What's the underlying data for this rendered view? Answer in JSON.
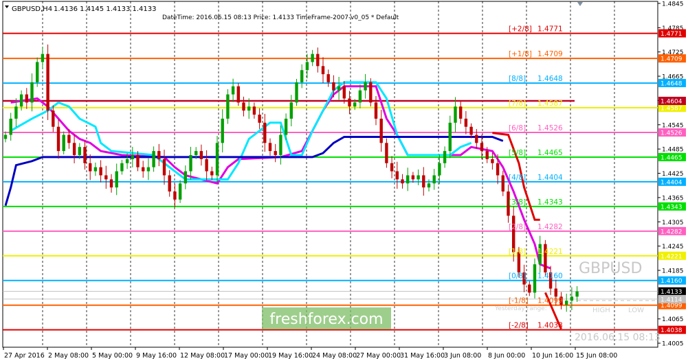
{
  "header": {
    "symbol_label": "GBPUSD,H4",
    "ohlc": "1.4136 1.4145 1.4133 1.4133",
    "info": "DateTime: 2016.06.15 08:13    Price: 1.4133    TimeFrame-2007-v0_05    *    Default"
  },
  "watermark": {
    "brand": "freshforex.com",
    "symbol": "GBPUSD",
    "datetime": "2016.06.15 08:13",
    "yesterday": "Yesterday range:",
    "high": "HIGH",
    "low": "LOW"
  },
  "colors": {
    "background": "#ffffff",
    "bull_candle": "#00a000",
    "bear_candle": "#c00000",
    "magenta": "#e000e0",
    "cyan": "#00e8ff",
    "blue": "#0000c0",
    "red_step": "#e00000",
    "grid": "#000000",
    "brand_box": "#7dbd66"
  },
  "chart_data": {
    "type": "candlestick",
    "ylim": [
      1.3995,
      1.485
    ],
    "y_ticks": [
      1.4845,
      1.4785,
      1.4725,
      1.4665,
      1.4605,
      1.4545,
      1.4485,
      1.4425,
      1.4365,
      1.4305,
      1.4245,
      1.4185,
      1.4125,
      1.4065,
      1.4005
    ],
    "x_labels": [
      "27 Apr 2016",
      "2 May 08:00",
      "5 May 00:00",
      "9 May 16:00",
      "12 May 08:00",
      "17 May 00:00",
      "19 May 16:00",
      "24 May 08:00",
      "27 May 00:00",
      "31 May 16:00",
      "3 Jun 08:00",
      "8 Jun 00:00",
      "10 Jun 16:00",
      "15 Jun 08:00"
    ],
    "murrey_levels": [
      {
        "label": "[+2/8]",
        "value": 1.4771,
        "price": "1.4771",
        "color": "#e00000"
      },
      {
        "label": "[+1/8]",
        "value": 1.4709,
        "price": "1.4709",
        "color": "#ff6000"
      },
      {
        "label": "[8/8]",
        "value": 1.4648,
        "price": "1.4648",
        "color": "#00b0ff"
      },
      {
        "label": "[7/8]",
        "value": 1.4587,
        "price": "1.4587",
        "color": "#f0f000"
      },
      {
        "label": "[6/8]",
        "value": 1.4526,
        "price": "1.4526",
        "color": "#ff60c0"
      },
      {
        "label": "[5/8]",
        "value": 1.4465,
        "price": "1.4465",
        "color": "#00e000"
      },
      {
        "label": "[4/8]",
        "value": 1.4404,
        "price": "1.4404",
        "color": "#00b0ff"
      },
      {
        "label": "[3/8]",
        "value": 1.4343,
        "price": "1.4343",
        "color": "#00e000"
      },
      {
        "label": "[2/8]",
        "value": 1.4282,
        "price": "1.4282",
        "color": "#ff60c0"
      },
      {
        "label": "[1/8]",
        "value": 1.4221,
        "price": "1.4221",
        "color": "#f0f000"
      },
      {
        "label": "[0/8]",
        "value": 1.416,
        "price": "1.4160",
        "color": "#00b0ff"
      },
      {
        "label": "[-1/8]",
        "value": 1.4099,
        "price": "1.4099",
        "color": "#ff6000"
      },
      {
        "label": "[-2/8]",
        "value": 1.4038,
        "price": "1.4038",
        "color": "#e00000"
      }
    ],
    "extra_lines": [
      {
        "value": 1.4604,
        "color": "#c00020",
        "price": "1.4604"
      }
    ],
    "price_markers": [
      {
        "value": 1.4133,
        "price": "1.4133",
        "color": "#000000"
      },
      {
        "value": 1.4114,
        "price": "1.4114",
        "color": "#c0c0c0"
      }
    ],
    "close_series": [
      1.452,
      1.456,
      1.459,
      1.462,
      1.46,
      1.465,
      1.47,
      1.472,
      1.458,
      1.454,
      1.448,
      1.452,
      1.45,
      1.447,
      1.449,
      1.445,
      1.443,
      1.444,
      1.442,
      1.441,
      1.439,
      1.443,
      1.445,
      1.446,
      1.447,
      1.444,
      1.443,
      1.444,
      1.448,
      1.446,
      1.442,
      1.438,
      1.436,
      1.44,
      1.443,
      1.447,
      1.448,
      1.446,
      1.443,
      1.442,
      1.45,
      1.456,
      1.462,
      1.464,
      1.46,
      1.458,
      1.459,
      1.457,
      1.455,
      1.45,
      1.448,
      1.447,
      1.452,
      1.456,
      1.46,
      1.465,
      1.468,
      1.47,
      1.472,
      1.469,
      1.467,
      1.465,
      1.463,
      1.464,
      1.461,
      1.459,
      1.46,
      1.463,
      1.465,
      1.46,
      1.456,
      1.45,
      1.445,
      1.443,
      1.441,
      1.44,
      1.442,
      1.441,
      1.442,
      1.439,
      1.44,
      1.442,
      1.445,
      1.448,
      1.455,
      1.459,
      1.456,
      1.454,
      1.452,
      1.45,
      1.448,
      1.446,
      1.445,
      1.442,
      1.438,
      1.432,
      1.423,
      1.418,
      1.415,
      1.413,
      1.42,
      1.425,
      1.418,
      1.414,
      1.412,
      1.41,
      1.411,
      1.412,
      1.4133
    ],
    "series": [
      {
        "name": "",
        "color": "#e000e0",
        "points": [
          [
            1,
            1.46
          ],
          [
            6,
            1.461
          ],
          [
            8,
            1.459
          ],
          [
            10,
            1.456
          ],
          [
            12,
            1.453
          ],
          [
            14,
            1.451
          ],
          [
            16,
            1.45
          ],
          [
            18,
            1.448
          ],
          [
            22,
            1.447
          ],
          [
            30,
            1.4465
          ],
          [
            32,
            1.444
          ],
          [
            34,
            1.442
          ],
          [
            40,
            1.44
          ],
          [
            42,
            1.444
          ],
          [
            44,
            1.446
          ],
          [
            52,
            1.4465
          ],
          [
            56,
            1.448
          ],
          [
            60,
            1.458
          ],
          [
            62,
            1.462
          ],
          [
            64,
            1.464
          ],
          [
            70,
            1.464
          ],
          [
            72,
            1.456
          ],
          [
            74,
            1.452
          ],
          [
            76,
            1.447
          ],
          [
            86,
            1.447
          ],
          [
            88,
            1.449
          ],
          [
            92,
            1.448
          ],
          [
            94,
            1.444
          ],
          [
            96,
            1.438
          ],
          [
            98,
            1.431
          ],
          [
            100,
            1.425
          ],
          [
            101,
            1.42
          ],
          [
            103,
            1.419
          ]
        ]
      },
      {
        "name": "",
        "color": "#00e8ff",
        "points": [
          [
            1,
            1.453
          ],
          [
            5,
            1.456
          ],
          [
            8,
            1.458
          ],
          [
            10,
            1.46
          ],
          [
            12,
            1.459
          ],
          [
            14,
            1.456
          ],
          [
            17,
            1.454
          ],
          [
            18,
            1.45
          ],
          [
            20,
            1.448
          ],
          [
            28,
            1.447
          ],
          [
            34,
            1.441
          ],
          [
            42,
            1.441
          ],
          [
            44,
            1.445
          ],
          [
            46,
            1.451
          ],
          [
            48,
            1.453
          ],
          [
            50,
            1.455
          ],
          [
            52,
            1.455
          ],
          [
            54,
            1.447
          ],
          [
            56,
            1.447
          ],
          [
            58,
            1.453
          ],
          [
            60,
            1.458
          ],
          [
            62,
            1.463
          ],
          [
            64,
            1.465
          ],
          [
            70,
            1.465
          ],
          [
            72,
            1.461
          ],
          [
            74,
            1.452
          ],
          [
            76,
            1.447
          ],
          [
            84,
            1.447
          ],
          [
            86,
            1.449
          ],
          [
            88,
            1.45
          ]
        ]
      },
      {
        "name": "",
        "color": "#0000c0",
        "points": [
          [
            0,
            1.4345
          ],
          [
            1,
            1.439
          ],
          [
            2,
            1.4445
          ],
          [
            5,
            1.4455
          ],
          [
            7,
            1.4465
          ],
          [
            58,
            1.4465
          ],
          [
            60,
            1.4475
          ],
          [
            62,
            1.45
          ],
          [
            64,
            1.4515
          ],
          [
            92,
            1.4515
          ],
          [
            94,
            1.4505
          ]
        ]
      },
      {
        "name": "",
        "color": "#e00000",
        "points": [
          [
            92,
            1.4525
          ],
          [
            95,
            1.452
          ],
          [
            97,
            1.445
          ],
          [
            98,
            1.439
          ],
          [
            100,
            1.431
          ],
          [
            101,
            1.431
          ]
        ]
      },
      {
        "name": "",
        "color": "#e00000",
        "points": [
          [
            102,
            1.413
          ],
          [
            105,
            1.404
          ]
        ]
      }
    ]
  }
}
